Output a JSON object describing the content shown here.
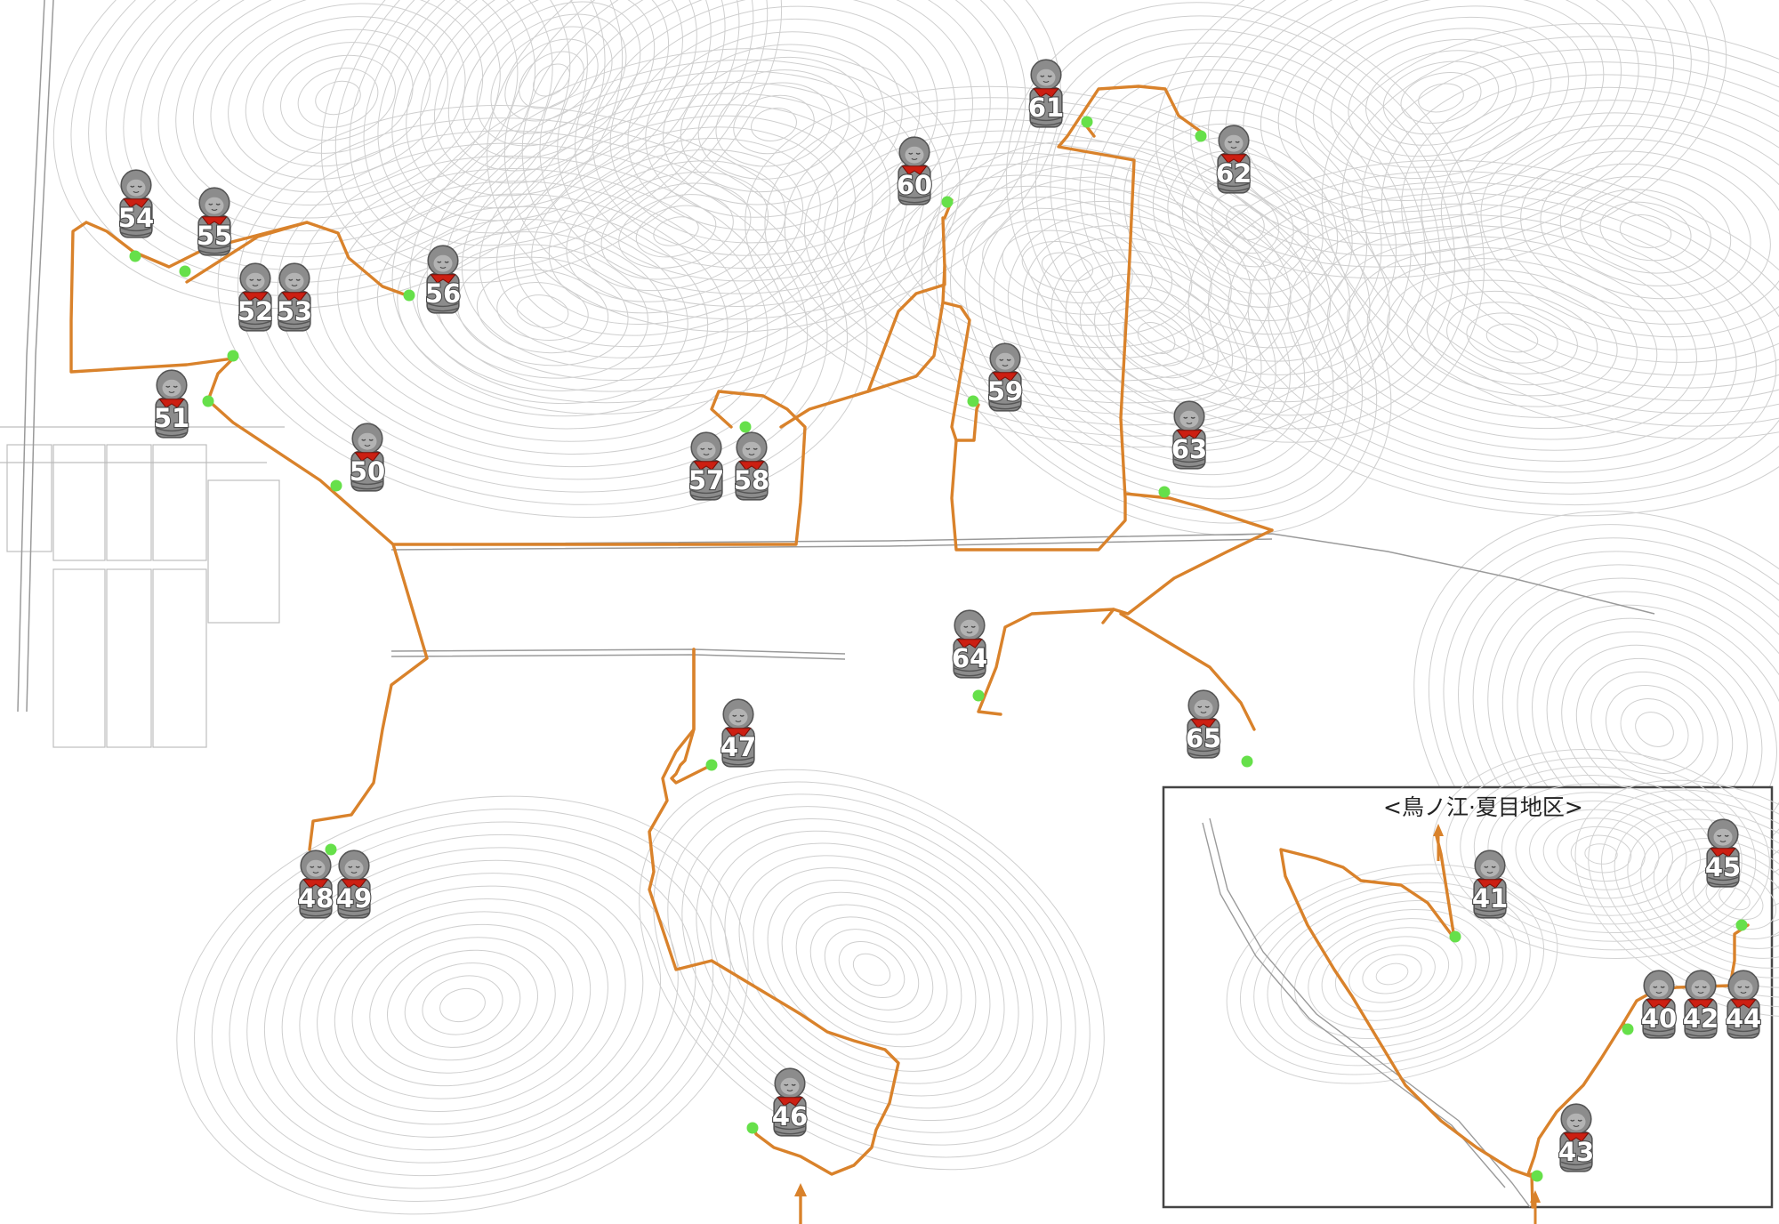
{
  "colors": {
    "route": "#d9822b",
    "marker": "#66e04a",
    "statue_body": "#8c8c8c",
    "statue_face": "#b3b3b3",
    "bib": "#cc1f12",
    "contour": "#cfcfcf",
    "background": "#ffffff"
  },
  "icons": {
    "statue": "jizo-statue-icon",
    "marker": "stop-marker-icon",
    "arrow": "route-arrow-icon"
  },
  "main_map": {
    "stops": [
      {
        "number": "46"
      },
      {
        "number": "47"
      },
      {
        "number": "48"
      },
      {
        "number": "49"
      },
      {
        "number": "50"
      },
      {
        "number": "51"
      },
      {
        "number": "52"
      },
      {
        "number": "53"
      },
      {
        "number": "54"
      },
      {
        "number": "55"
      },
      {
        "number": "56"
      },
      {
        "number": "57"
      },
      {
        "number": "58"
      },
      {
        "number": "59"
      },
      {
        "number": "60"
      },
      {
        "number": "61"
      },
      {
        "number": "62"
      },
      {
        "number": "63"
      },
      {
        "number": "64"
      },
      {
        "number": "65"
      }
    ]
  },
  "inset": {
    "title": "<鳥ノ江·夏目地区>",
    "stops": [
      {
        "number": "40"
      },
      {
        "number": "41"
      },
      {
        "number": "42"
      },
      {
        "number": "43"
      },
      {
        "number": "44"
      },
      {
        "number": "45"
      }
    ]
  }
}
